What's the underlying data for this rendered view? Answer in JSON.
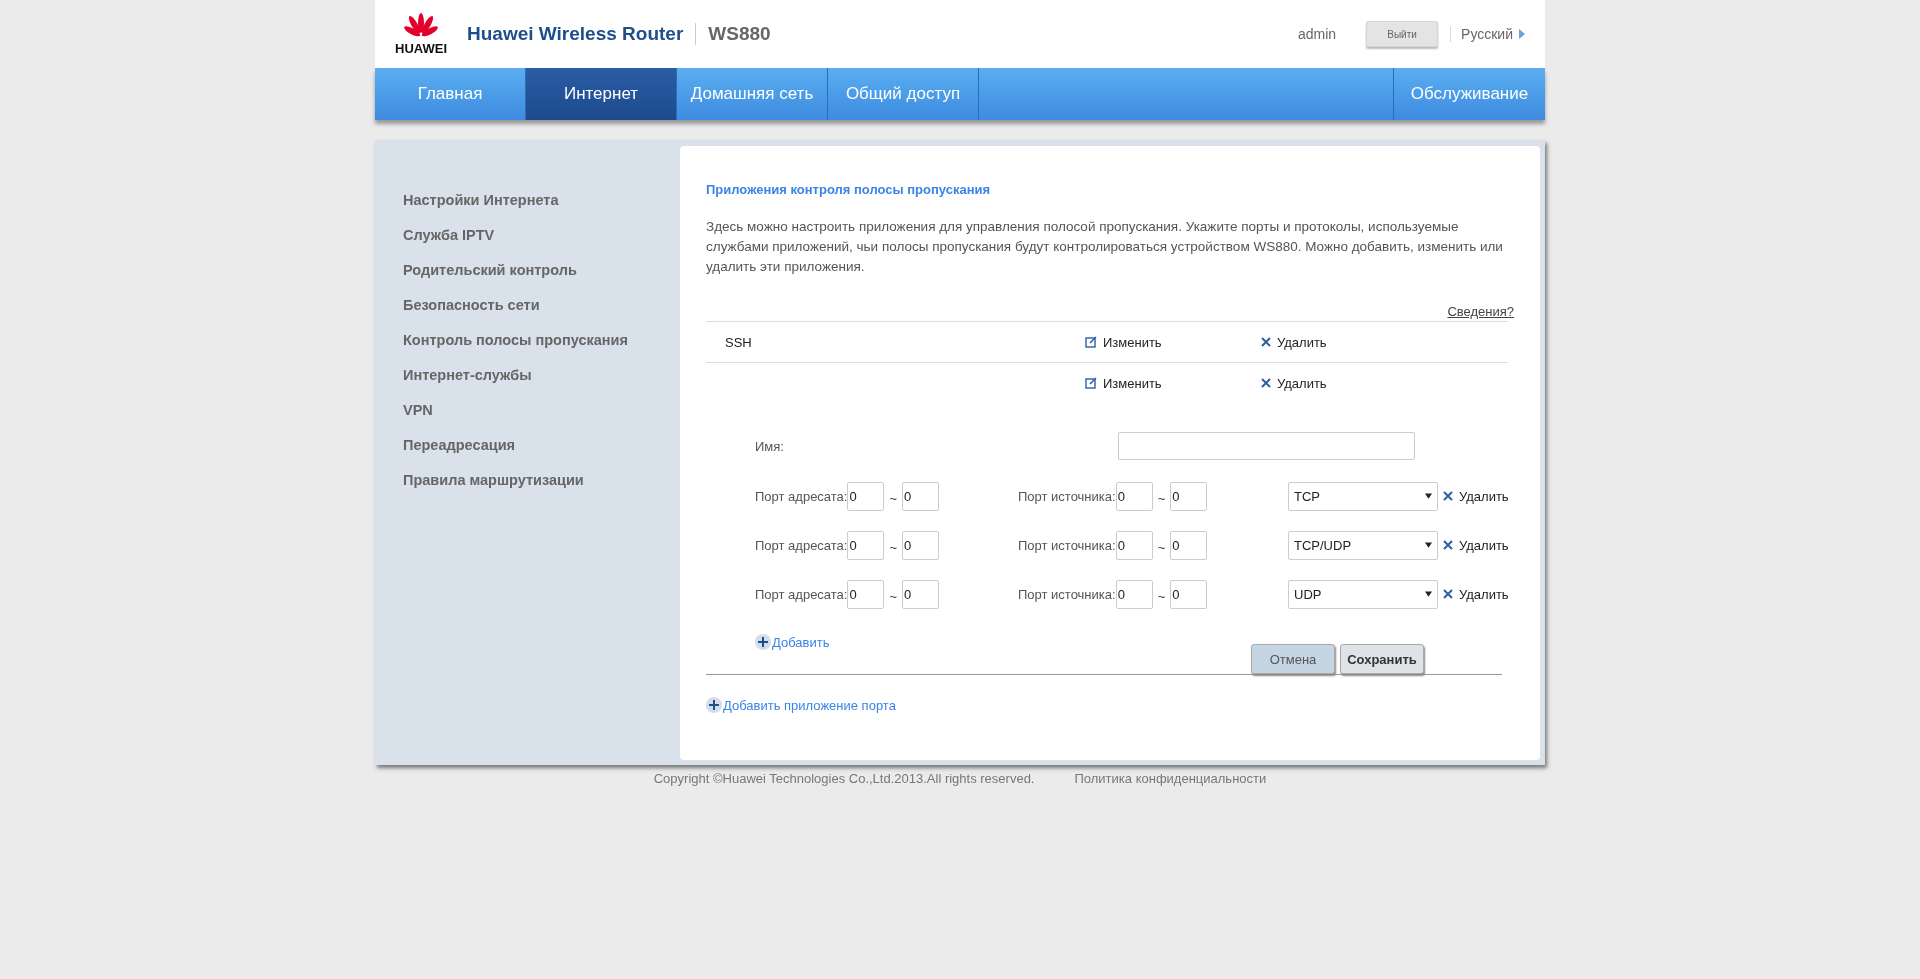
{
  "header": {
    "logo_text": "HUAWEI",
    "title": "Huawei Wireless Router",
    "model": "WS880",
    "user": "admin",
    "logout_button": "Выйти",
    "language": "Русский"
  },
  "nav": {
    "tabs": [
      {
        "label": "Главная",
        "selected": false
      },
      {
        "label": "Интернет",
        "selected": true
      },
      {
        "label": "Домашняя сеть",
        "selected": false
      },
      {
        "label": "Общий доступ",
        "selected": false
      }
    ],
    "right_tabs": [
      {
        "label": "Обслуживание",
        "selected": false
      }
    ]
  },
  "sidebar": {
    "items": [
      {
        "label": "Настройки Интернета"
      },
      {
        "label": "Служба IPTV"
      },
      {
        "label": "Родительский контроль"
      },
      {
        "label": "Безопасность сети"
      },
      {
        "label": "Контроль полосы пропускания"
      },
      {
        "label": "Интернет-службы"
      },
      {
        "label": "VPN"
      },
      {
        "label": "Переадресация"
      },
      {
        "label": "Правила маршрутизации"
      }
    ]
  },
  "content": {
    "title": "Приложения контроля полосы пропускания",
    "description": "Здесь можно настроить приложения для управления полосой пропускания. Укажите порты и протоколы, используемые службами приложений, чьи полосы пропускания будут контролироваться устройством WS880. Можно добавить, изменить или удалить эти приложения.",
    "help_link": "Сведения?",
    "apps": [
      {
        "name": "SSH",
        "edit": "Изменить",
        "delete": "Удалить"
      },
      {
        "edit": "Изменить",
        "delete": "Удалить"
      }
    ],
    "form": {
      "name_label": "Имя:",
      "port_rules": [
        {
          "dest_label": "Порт адресата:",
          "dest_from": "0",
          "dest_sep": "~",
          "dest_to": "0",
          "src_label": "Порт источника:",
          "src_from": "0",
          "src_sep": "~",
          "src_to": "0",
          "protocol": "TCP",
          "delete": "Удалить"
        },
        {
          "dest_label": "Порт адресата:",
          "dest_from": "0",
          "dest_sep": "~",
          "dest_to": "0",
          "src_label": "Порт источника:",
          "src_from": "0",
          "src_sep": "~",
          "src_to": "0",
          "protocol": "TCP/UDP",
          "delete": "Удалить"
        },
        {
          "dest_label": "Порт адресата:",
          "dest_from": "0",
          "dest_sep": "~",
          "dest_to": "0",
          "src_label": "Порт источника:",
          "src_from": "0",
          "src_sep": "~",
          "src_to": "0",
          "protocol": "UDP",
          "delete": "Удалить"
        }
      ],
      "add_button": "Добавить",
      "cancel_button": "Отмена",
      "save_button": "Сохранить"
    },
    "add_app_button": "Добавить приложение порта"
  },
  "footer": {
    "copyright": "Copyright ©Huawei Technologies Co.,Ltd.2013.All rights reserved.",
    "privacy_link": "Политика конфиденциальности"
  }
}
